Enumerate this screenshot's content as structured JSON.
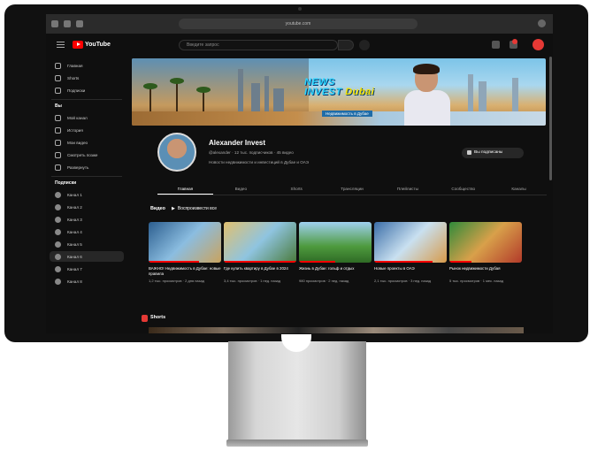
{
  "browser": {
    "url": "youtube.com"
  },
  "header": {
    "logo_text": "YouTube",
    "search_placeholder": "Введите запрос"
  },
  "sidebar": {
    "items_top": [
      {
        "label": "Главная",
        "icon": "home-icon"
      },
      {
        "label": "Shorts",
        "icon": "shorts-icon"
      },
      {
        "label": "Подписки",
        "icon": "subscriptions-icon"
      }
    ],
    "section_you": "Вы",
    "items_you": [
      {
        "label": "Мой канал",
        "icon": "channel-icon"
      },
      {
        "label": "История",
        "icon": "history-icon"
      },
      {
        "label": "Мои видео",
        "icon": "videos-icon"
      },
      {
        "label": "Смотреть позже",
        "icon": "watch-later-icon"
      },
      {
        "label": "Развернуть",
        "icon": "chevron-down-icon"
      }
    ],
    "section_subs": "Подписки",
    "subs": [
      {
        "label": "Канал 1"
      },
      {
        "label": "Канал 2"
      },
      {
        "label": "Канал 3"
      },
      {
        "label": "Канал 4"
      },
      {
        "label": "Канал 5"
      },
      {
        "label": "Канал 6",
        "active": true
      },
      {
        "label": "Канал 7"
      },
      {
        "label": "Канал 8"
      }
    ]
  },
  "banner": {
    "title_line1": "NEWS",
    "title_line2": "INVEST",
    "title_accent": "Dubai",
    "subtitle": "Недвижимость в Дубае"
  },
  "channel": {
    "name": "Alexander Invest",
    "meta": "@alexander · 12 тыс. подписчиков · 45 видео",
    "description": "Новости недвижимости и инвестиций в Дубае и ОАЭ",
    "subscribe_label": "Вы подписаны"
  },
  "tabs": [
    "Главная",
    "Видео",
    "Shorts",
    "Трансляции",
    "Плейлисты",
    "Сообщество",
    "Каналы"
  ],
  "section_videos": {
    "title": "Видео",
    "play_all": "Воспроизвести все"
  },
  "videos": [
    {
      "title": "ВАЖНО! Недвижимость в Дубае: новые правила",
      "meta": "1,2 тыс. просмотров · 2 дня назад",
      "progress": 0.7
    },
    {
      "title": "Где купить квартиру в Дубае в 2024",
      "meta": "3,4 тыс. просмотров · 1 нед. назад",
      "progress": 1.0
    },
    {
      "title": "Жизнь в Дубае: гольф и отдых",
      "meta": "980 просмотров · 2 нед. назад",
      "progress": 0.5
    },
    {
      "title": "Новые проекты в ОАЭ",
      "meta": "2,1 тыс. просмотров · 3 нед. назад",
      "progress": 0.8
    },
    {
      "title": "Рынок недвижимости Дубая",
      "meta": "5 тыс. просмотров · 1 мес. назад",
      "progress": 0.3
    }
  ],
  "section_shorts": {
    "title": "Shorts"
  }
}
